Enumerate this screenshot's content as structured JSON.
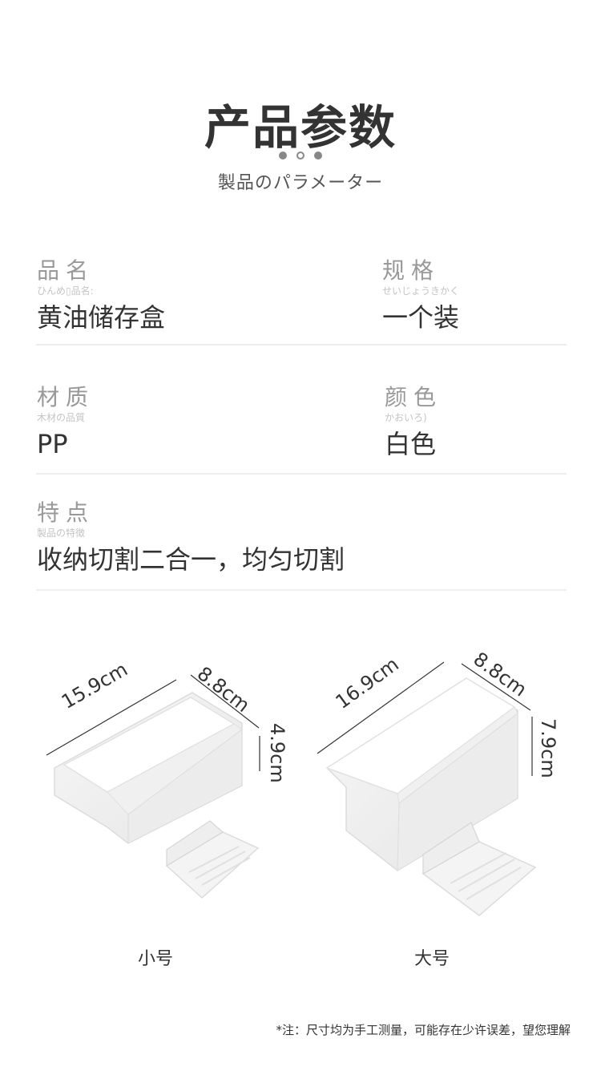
{
  "header": {
    "title": "产品参数",
    "subtitle": "製品のパラメーター"
  },
  "params": {
    "name": {
      "label": "品名",
      "kana": "ひんめ▯品名:",
      "value": "黄油储存盒"
    },
    "spec": {
      "label": "规格",
      "kana": "せいじょうきかく",
      "value": "一个装"
    },
    "material": {
      "label": "材质",
      "kana": "木材の品質",
      "value": "PP"
    },
    "color": {
      "label": "颜色",
      "kana": "かおいろ)",
      "value": "白色"
    },
    "feature": {
      "label": "特点",
      "kana": "製品の特徴",
      "value": "收纳切割二合一，均匀切割"
    }
  },
  "products": {
    "small": {
      "length": "15.9cm",
      "width": "8.8cm",
      "height": "4.9cm",
      "caption": "小号"
    },
    "large": {
      "length": "16.9cm",
      "width": "8.8cm",
      "height": "7.9cm",
      "caption": "大号"
    }
  },
  "footnote": "*注：尺寸均为手工测量，可能存在少许误差，望您理解",
  "colors": {
    "text": "#333333",
    "label": "#999999",
    "divider": "#eeeeee",
    "box": "#ffffff"
  }
}
